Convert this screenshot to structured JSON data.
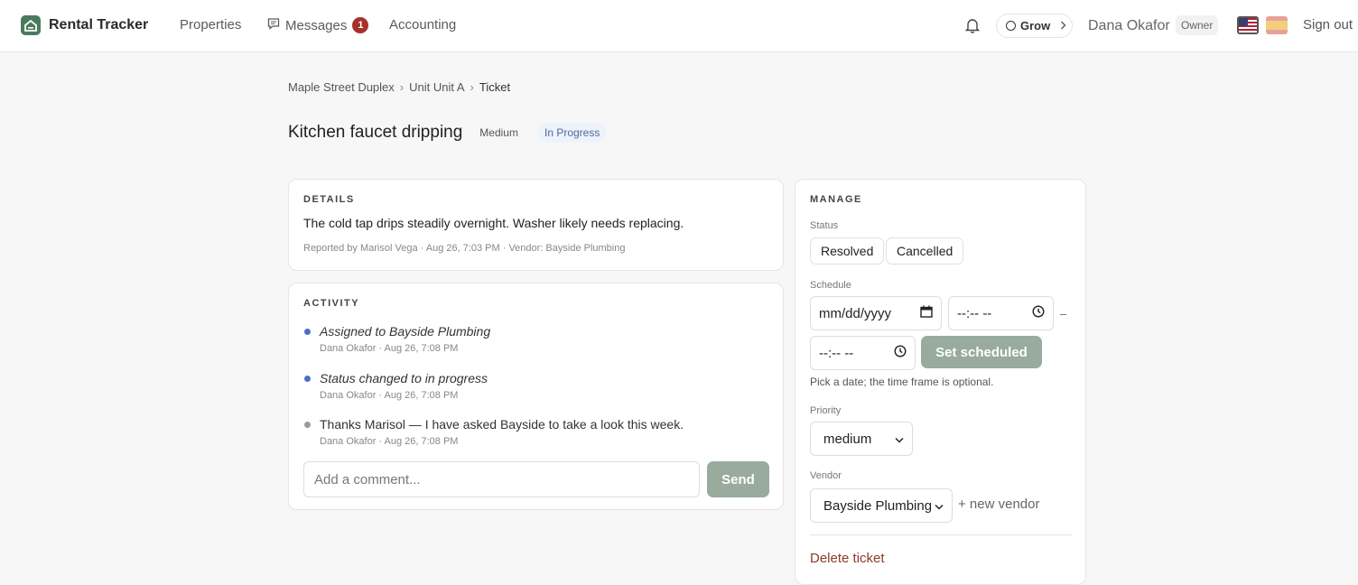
{
  "app": {
    "name": "Rental Tracker"
  },
  "nav": {
    "properties": "Properties",
    "messages": "Messages",
    "messages_count": "1",
    "accounting": "Accounting"
  },
  "header": {
    "grow_label": "Grow",
    "user_name": "Dana Okafor",
    "role": "Owner",
    "sign_out": "Sign out"
  },
  "breadcrumb": {
    "property": "Maple Street Duplex",
    "unit": "Unit Unit A",
    "current": "Ticket",
    "sep": "›"
  },
  "ticket": {
    "title": "Kitchen faucet dripping",
    "priority_badge": "Medium",
    "status_badge": "In Progress"
  },
  "details": {
    "label": "DETAILS",
    "text": "The cold tap drips steadily overnight. Washer likely needs replacing.",
    "meta": "Reported by Marisol Vega · Aug 26, 7:03 PM · Vendor: Bayside Plumbing"
  },
  "activity": {
    "label": "ACTIVITY",
    "items": [
      {
        "title": "Assigned to Bayside Plumbing",
        "meta": "Dana Okafor · Aug 26, 7:08 PM",
        "dot_color": "#4a6fc4"
      },
      {
        "title": "Status changed to in progress",
        "meta": "Dana Okafor · Aug 26, 7:08 PM",
        "dot_color": "#4a6fc4"
      },
      {
        "title": "Thanks Marisol — I have asked Bayside to take a look this week.",
        "meta": "Dana Okafor · Aug 26, 7:08 PM",
        "dot_color": "#9a9a9a"
      }
    ],
    "comment_placeholder": "Add a comment...",
    "send_label": "Send"
  },
  "manage": {
    "label": "MANAGE",
    "status_label": "Status",
    "status_options": [
      "Resolved",
      "Cancelled"
    ],
    "schedule_label": "Schedule",
    "date_placeholder": "mm/dd/yyyy",
    "time_placeholder": "--:-- --",
    "dash": "–",
    "set_scheduled_label": "Set scheduled",
    "hint": "Pick a date; the time frame is optional.",
    "priority_label": "Priority",
    "priority_value": "medium",
    "vendor_label": "Vendor",
    "vendor_value": "Bayside Plumbing",
    "new_vendor": "+ new vendor",
    "delete_label": "Delete ticket"
  },
  "colors": {
    "brand": "#4b7a5e",
    "accent_button": "#98ab9c",
    "badge": "#a5322a",
    "status_badge_text": "#4a6aa5",
    "delete": "#8b3a2a"
  }
}
